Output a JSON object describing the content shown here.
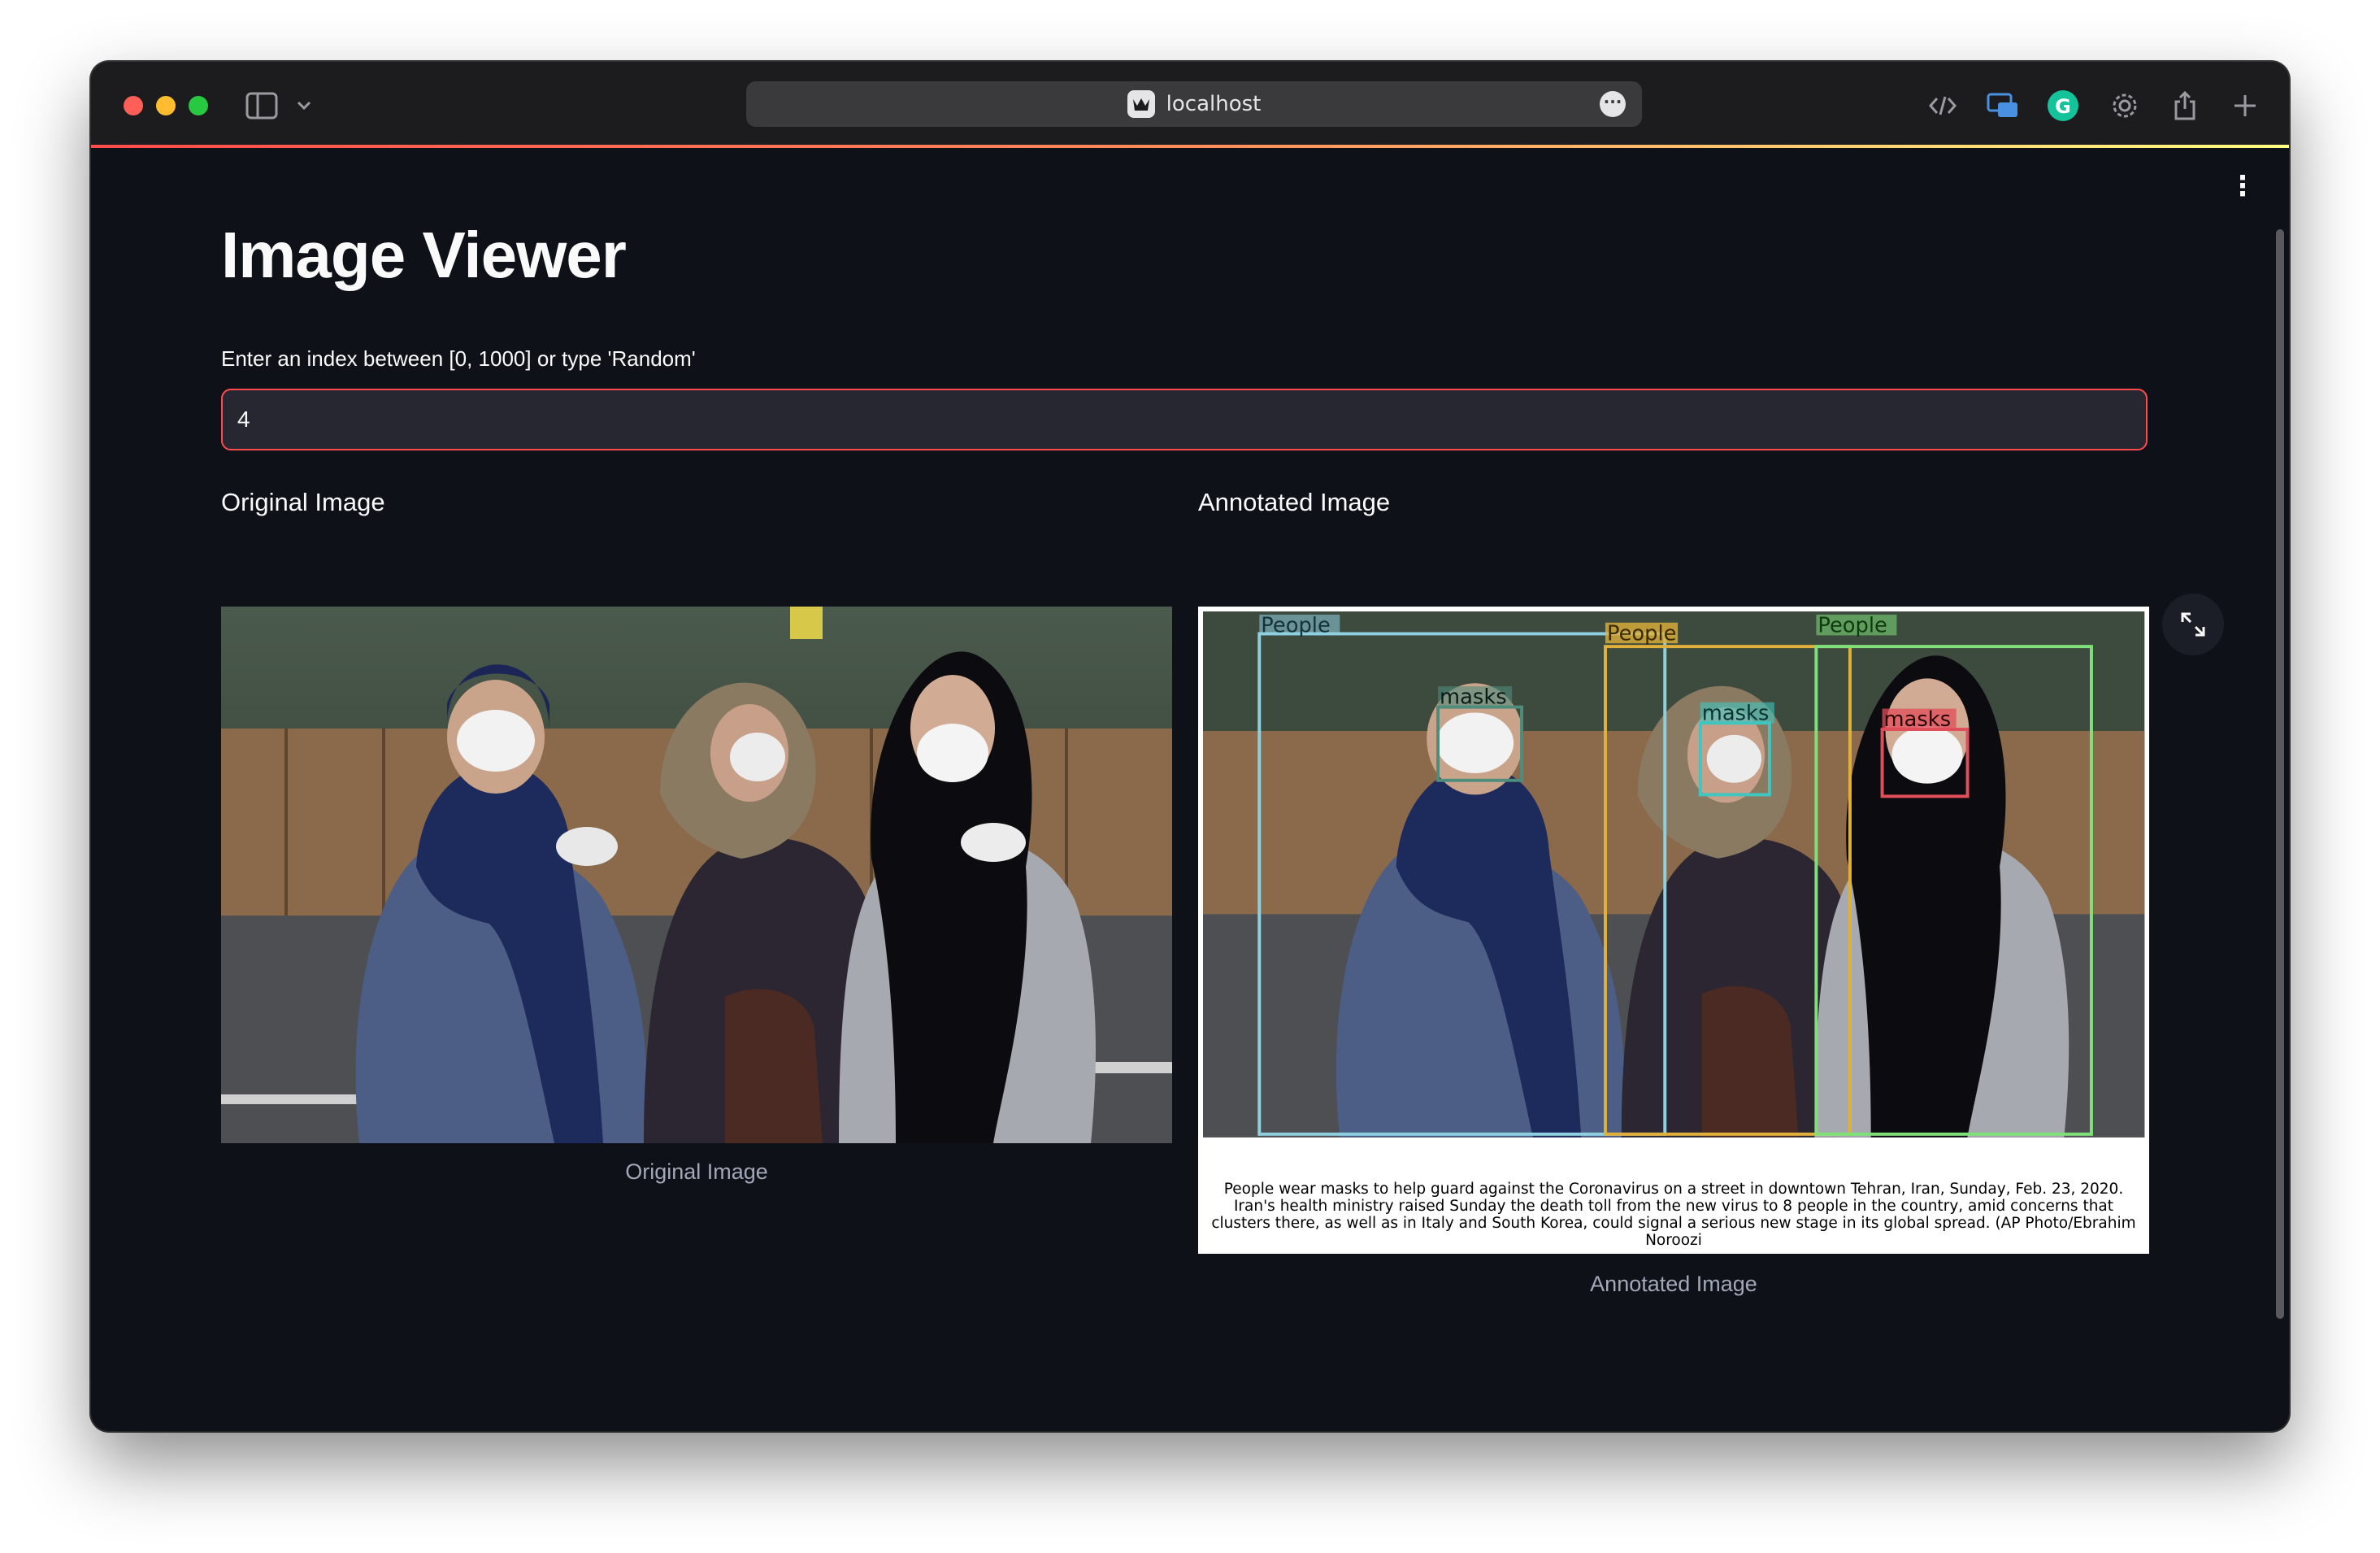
{
  "browser": {
    "url": "localhost",
    "icons": [
      "sidebar-icon",
      "chevron-down-icon",
      "dev-tools-icon",
      "screen-share-icon",
      "grammarly-icon",
      "gear-icon",
      "share-icon",
      "plus-icon"
    ],
    "grammarly_letter": "G"
  },
  "app": {
    "title": "Image Viewer",
    "index_label": "Enter an index between [0, 1000] or type 'Random'",
    "index_value": "4",
    "accent_color": "#ff4b4b",
    "background_color": "#0e1117"
  },
  "original": {
    "heading": "Original Image",
    "caption": "Original Image"
  },
  "annotated": {
    "heading": "Annotated Image",
    "caption": "Annotated Image",
    "box_labels": [
      "People",
      "People",
      "People",
      "masks",
      "masks",
      "masks"
    ],
    "image_text": "People wear masks to help guard against the Coronavirus on a street in downtown Tehran, Iran, Sunday, Feb. 23, 2020. Iran's health ministry raised Sunday the death toll from the new virus to 8 people in the country, amid concerns that clusters there, as well as in Italy and South Korea, could signal a serious new stage in its global spread. (AP Photo/Ebrahim Noroozi"
  }
}
